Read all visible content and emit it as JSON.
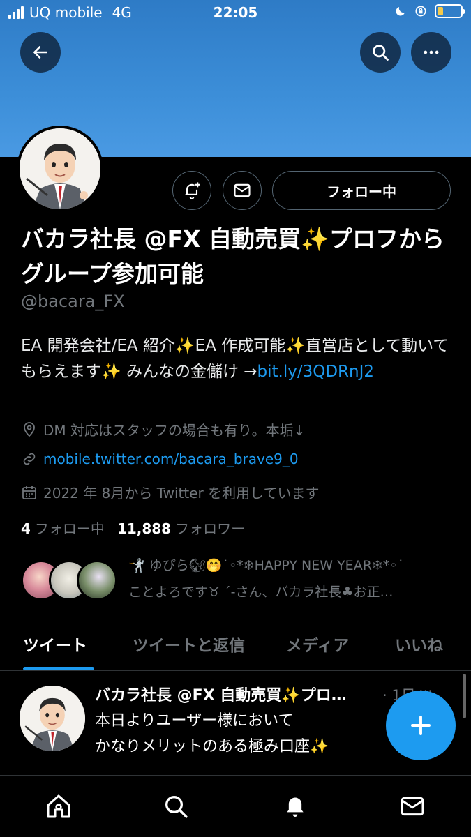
{
  "status_bar": {
    "carrier": "UQ mobile",
    "network": "4G",
    "time": "22:05"
  },
  "header": {
    "back_icon": "arrow-left-icon",
    "search_icon": "search-icon",
    "more_icon": "more-horizontal-icon"
  },
  "profile": {
    "display_name": "バカラ社長 @FX 自動売買✨プロフからグループ参加可能",
    "handle": "@bacara_FX",
    "bio_text": "EA 開発会社/EA 紹介✨EA 作成可能✨直営店として動いてもらえます✨ みんなの金儲け →",
    "bio_link": "bit.ly/3QDRnJ2",
    "location": "DM 対応はスタッフの場合も有り。本垢↓",
    "website": "mobile.twitter.com/bacara_brave9_0",
    "joined": "2022 年 8月から Twitter を利用しています",
    "following_count": "4",
    "following_label": "フォロー中",
    "followers_count": "11,888",
    "followers_label": "フォロワー",
    "follow_button_label": "フォロー中",
    "followed_by_line1": "ゆぴら🐿🤭˙◦*❄HAPPY NEW YEAR❄*◦˙",
    "followed_by_line2": "ことよろです♉︎ ´-さん、バカラ社長♣お正…"
  },
  "tabs": [
    {
      "label": "ツイート",
      "active": true
    },
    {
      "label": "ツイートと返信",
      "active": false
    },
    {
      "label": "メディア",
      "active": false
    },
    {
      "label": "いいね",
      "active": false
    }
  ],
  "tweet": {
    "author": "バカラ社長 @FX 自動売買✨プロ…",
    "time": "· 1日",
    "more": "···",
    "line1": "本日よりユーザー様において",
    "line2": "かなりメリットのある極み口座✨"
  },
  "colors": {
    "accent": "#1d9bf0",
    "banner": "#3c8ed8",
    "background": "#000000",
    "muted_text": "#71767b"
  }
}
